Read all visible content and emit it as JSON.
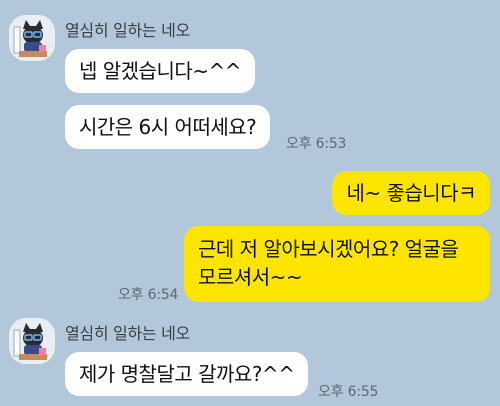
{
  "conversation": {
    "messages": [
      {
        "direction": "in",
        "sender": "열심히 일하는 네오",
        "text": "넵 알겠습니다~^^",
        "time": ""
      },
      {
        "direction": "in",
        "sender": "",
        "text": "시간은 6시 어떠세요?",
        "time": "오후 6:53"
      },
      {
        "direction": "out",
        "text": "네~ 좋습니다ㅋ",
        "time": ""
      },
      {
        "direction": "out",
        "lines": [
          "근데 저 알아보시겠어요? 얼굴을",
          "모르셔서~~"
        ],
        "time": "오후 6:54"
      },
      {
        "direction": "in",
        "sender": "열심히 일하는 네오",
        "text": "제가 명찰달고 갈까요?^^",
        "time": "오후 6:55"
      }
    ]
  },
  "colors": {
    "background": "#b2c7d9",
    "incoming_bubble": "#ffffff",
    "outgoing_bubble": "#fee500",
    "timestamp": "#5d6974"
  },
  "icons": {
    "avatar": "neo-character-avatar-icon"
  }
}
